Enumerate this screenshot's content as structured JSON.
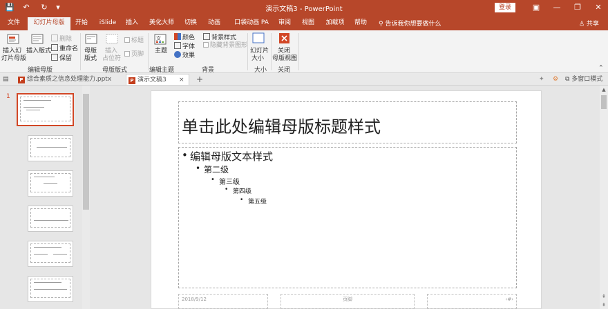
{
  "titlebar": {
    "title": "演示文稿3  -  PowerPoint",
    "login": "登录",
    "qa_save": "💾",
    "qa_undo": "↶",
    "qa_redo": "↻",
    "qa_more": "▾",
    "minimize": "—",
    "restore": "❐",
    "close": "✕",
    "ribbon_opts": "▣"
  },
  "tabs": {
    "items": [
      "文件",
      "幻灯片母版",
      "开始",
      "iSlide",
      "插入",
      "美化大师",
      "切换",
      "动画",
      "口袋动画 PA",
      "审阅",
      "视图",
      "加载项",
      "帮助"
    ],
    "active_index": 1,
    "tell_me": "⚲ 告诉我你想要做什么",
    "share": "♙ 共享"
  },
  "ribbon": {
    "groups": {
      "edit_master": "编辑母版",
      "master_layout": "母版版式",
      "edit_theme": "编辑主题",
      "background": "背景",
      "size": "大小",
      "close": "关闭"
    },
    "insert_master": [
      "插入幻",
      "灯片母版"
    ],
    "insert_layout": "插入版式",
    "delete": "删除",
    "rename": "重命名",
    "preserve": "保留",
    "master_layout_btn": [
      "母版",
      "版式"
    ],
    "insert_placeholder": [
      "插入",
      "占位符"
    ],
    "title_chk": "标题",
    "footer_chk": "页脚",
    "theme": "主题",
    "colors": "颜色",
    "fonts": "字体",
    "effects": "效果",
    "bg_styles": "背景样式",
    "hide_bg": "隐藏背景图形",
    "slide_size": [
      "幻灯片",
      "大小"
    ],
    "close_master": [
      "关闭",
      "母版视图"
    ]
  },
  "doctabs": {
    "tab1": "综合素质之信息处理能力.pptx",
    "tab2": "演示文稿3",
    "add": "+",
    "multi_window": "多窗口模式"
  },
  "thumbs": {
    "slide_number": "1"
  },
  "slide": {
    "title": "单击此处编辑母版标题样式",
    "levels": [
      "编辑母版文本样式",
      "第二级",
      "第三级",
      "第四级",
      "第五级"
    ],
    "footer_date": "2018/9/12",
    "footer_text": "页脚",
    "footer_num": "‹#›"
  }
}
